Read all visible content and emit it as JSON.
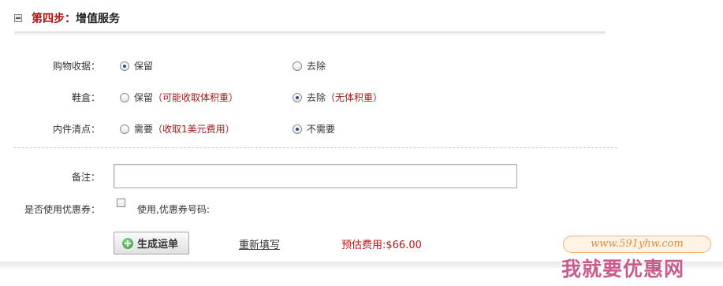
{
  "section": {
    "step": "第四步：",
    "title": "增值服务"
  },
  "options": {
    "receipt": {
      "label": "购物收据：",
      "opt1": "保留",
      "opt2": "去除",
      "selected": "保留"
    },
    "shoebox": {
      "label": "鞋盒：",
      "opt1": "保留",
      "opt1_note": "（可能收取体积重）",
      "opt2": "去除",
      "opt2_note": "（无体积重）",
      "selected": "去除"
    },
    "inspection": {
      "label": "内件清点：",
      "opt1": "需要",
      "opt1_note": "（收取1美元费用）",
      "opt2": "不需要",
      "selected": "不需要"
    }
  },
  "remark": {
    "label": "备注：",
    "value": ""
  },
  "coupon": {
    "label": "是否使用优惠券：",
    "checkbox_text": "使用,优惠券号码:",
    "checked": false
  },
  "actions": {
    "generate": "生成运单",
    "reset": "重新填写",
    "fee": "预估费用:$66.00"
  },
  "watermark": {
    "url": "www.591yhw.com",
    "text": "我就要优惠网"
  },
  "colors": {
    "accent_red": "#b01010",
    "fee_red": "#c01717",
    "note_red": "#a11a1a",
    "button_icon_green": "#2e9a2e"
  }
}
